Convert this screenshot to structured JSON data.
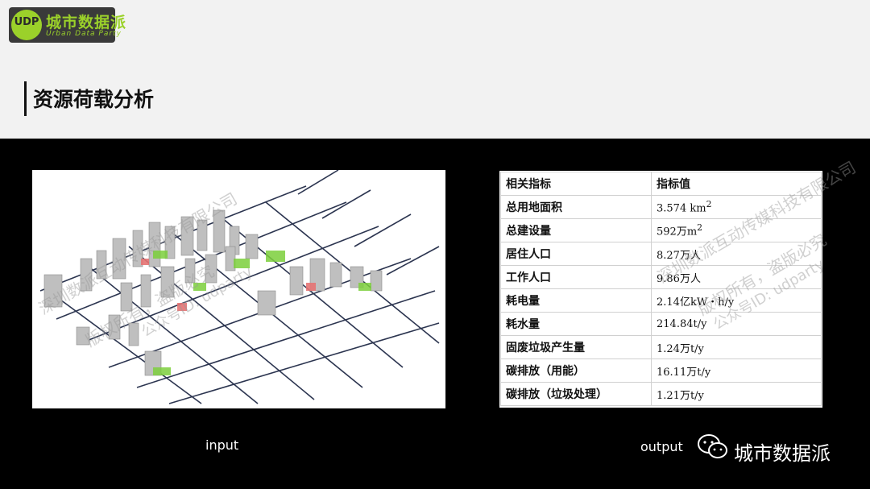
{
  "logo": {
    "badge_text": "UDP",
    "title": "城市数据派",
    "subtitle": "Urban Data Party"
  },
  "page_title": "资源荷载分析",
  "table": {
    "headers": [
      "相关指标",
      "指标值"
    ],
    "rows": [
      {
        "label": "总用地面积",
        "value": "3.574 km",
        "sup": "2"
      },
      {
        "label": "总建设量",
        "value": "592万m",
        "sup": "2"
      },
      {
        "label": "居住人口",
        "value": "8.27万人",
        "sup": ""
      },
      {
        "label": "工作人口",
        "value": "9.86万人",
        "sup": ""
      },
      {
        "label": "耗电量",
        "value": "2.14亿kW・h/y",
        "sup": ""
      },
      {
        "label": "耗水量",
        "value": "214.84t/y",
        "sup": ""
      },
      {
        "label": "固废垃圾产生量",
        "value": "1.24万t/y",
        "sup": ""
      },
      {
        "label": "碳排放（用能）",
        "value": "16.11万t/y",
        "sup": ""
      },
      {
        "label": "碳排放（垃圾处理）",
        "value": "1.21万t/y",
        "sup": ""
      }
    ]
  },
  "captions": {
    "input": "input",
    "output": "output"
  },
  "brand": "城市数据派",
  "watermarks": {
    "left_1": "深圳数派互动传媒科技有限公司",
    "left_2": "版权所有，盗版必究",
    "left_3": "公众号ID: udparty",
    "right_1": "深圳数派互动传媒科技有限公司",
    "right_2": "版权所有，盗版必究",
    "right_3": "公众号ID: udparty"
  },
  "colors": {
    "accent": "#9bd12a",
    "header_bg": "#f2f2f2",
    "body_bg": "#000000"
  }
}
